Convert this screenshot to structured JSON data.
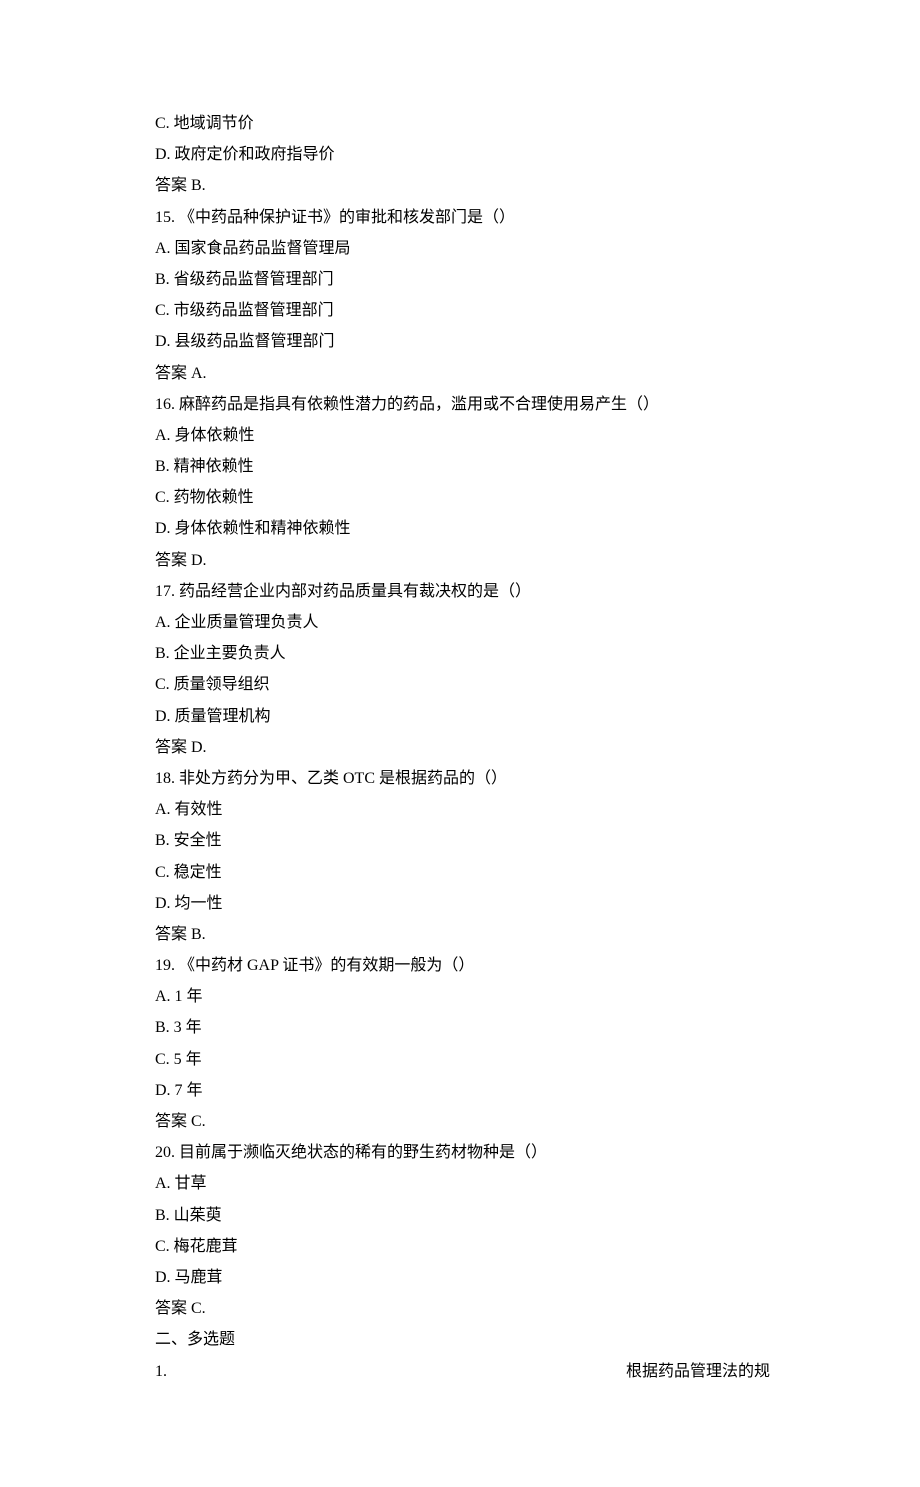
{
  "lines": {
    "c": "C. 地域调节价",
    "d": "D. 政府定价和政府指导价",
    "ans14": "答案 B."
  },
  "q15": {
    "stem": "15. 《中药品种保护证书》的审批和核发部门是（）",
    "a": "A. 国家食品药品监督管理局",
    "b": "B. 省级药品监督管理部门",
    "c": "C. 市级药品监督管理部门",
    "d": "D. 县级药品监督管理部门",
    "ans": "答案 A."
  },
  "q16": {
    "stem": "16. 麻醉药品是指具有依赖性潜力的药品，滥用或不合理使用易产生（）",
    "a": "A. 身体依赖性",
    "b": "B. 精神依赖性",
    "c": "C. 药物依赖性",
    "d": "D. 身体依赖性和精神依赖性",
    "ans": "答案 D."
  },
  "q17": {
    "stem": "17. 药品经营企业内部对药品质量具有裁决权的是（）",
    "a": "A. 企业质量管理负责人",
    "b": "B. 企业主要负责人",
    "c": "C. 质量领导组织",
    "d": "D. 质量管理机构",
    "ans": "答案 D."
  },
  "q18": {
    "stem": "18. 非处方药分为甲、乙类 OTC 是根据药品的（）",
    "a": "A. 有效性",
    "b": "B. 安全性",
    "c": "C. 稳定性",
    "d": "D. 均一性",
    "ans": "答案 B."
  },
  "q19": {
    "stem": "19. 《中药材 GAP 证书》的有效期一般为（）",
    "a": "A. 1 年",
    "b": "B. 3 年",
    "c": "C. 5 年",
    "d": "D. 7 年",
    "ans": "答案 C."
  },
  "q20": {
    "stem": "20. 目前属于濒临灭绝状态的稀有的野生药材物种是（）",
    "a": "A. 甘草",
    "b": "B. 山茱萸",
    "c": "C. 梅花鹿茸",
    "d": "D. 马鹿茸",
    "ans": "答案 C."
  },
  "section2": {
    "title": "二、多选题",
    "q1_left": "1.",
    "q1_right": "根据药品管理法的规"
  }
}
